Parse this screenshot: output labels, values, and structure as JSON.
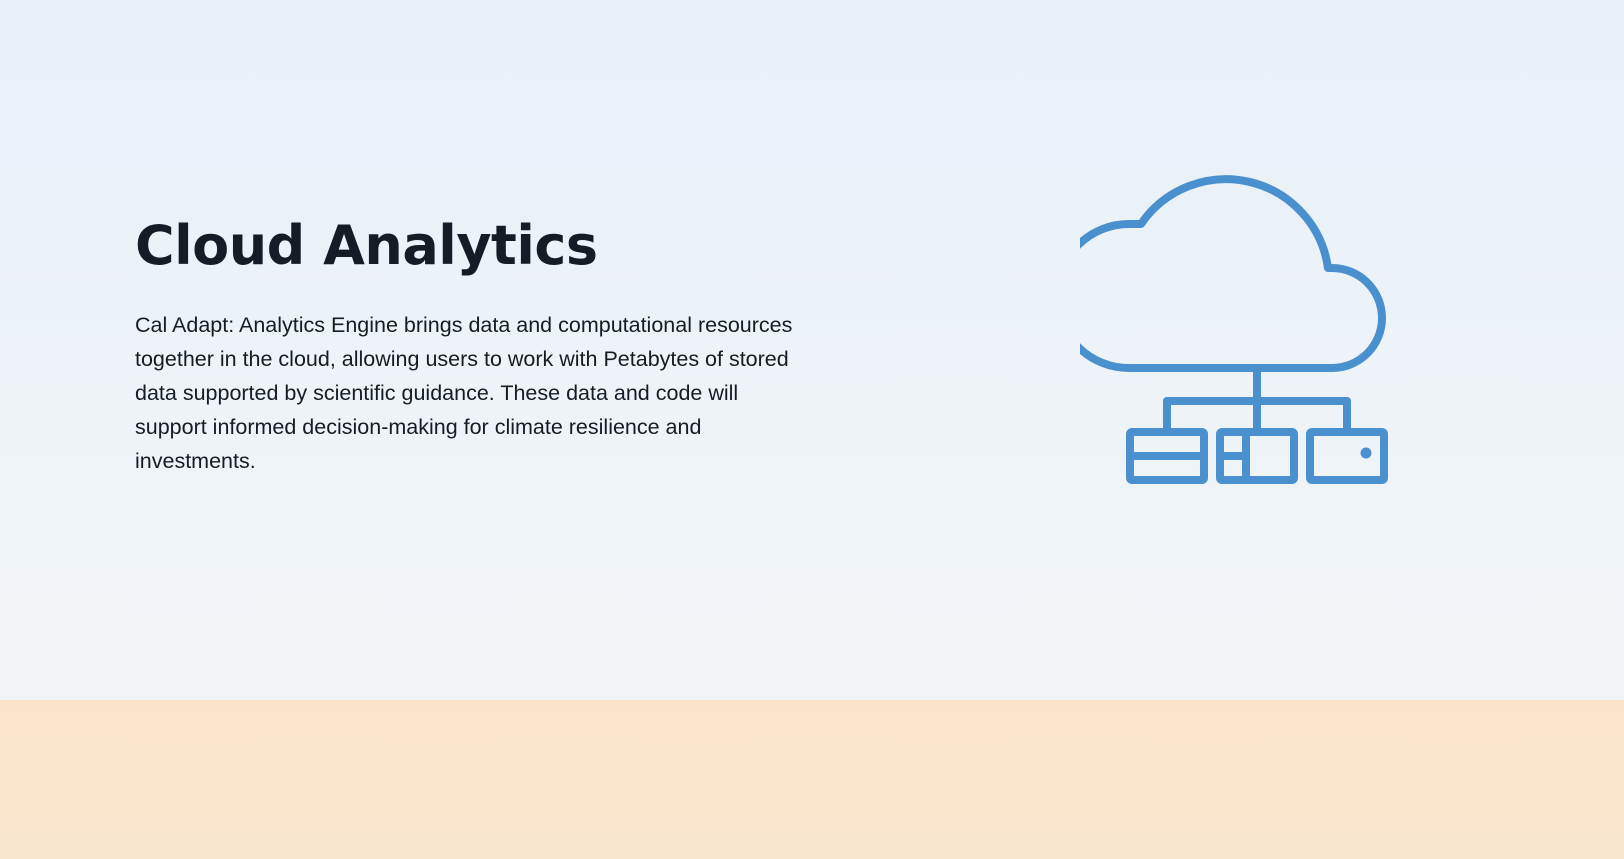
{
  "hero": {
    "title": "Cloud Analytics",
    "description": "Cal Adapt: Analytics Engine brings data and computational resources together in the cloud, allowing users to work with Petabytes of stored data supported by scientific guidance. These data and code will support informed decision-making for climate resilience and investments."
  },
  "illustration": {
    "icon": "cloud-network-icon",
    "stroke_color": "#4a90cf"
  },
  "colors": {
    "hero_background": "#eaf2f9",
    "footer_band": "#fae5cc",
    "text": "#161c26"
  }
}
